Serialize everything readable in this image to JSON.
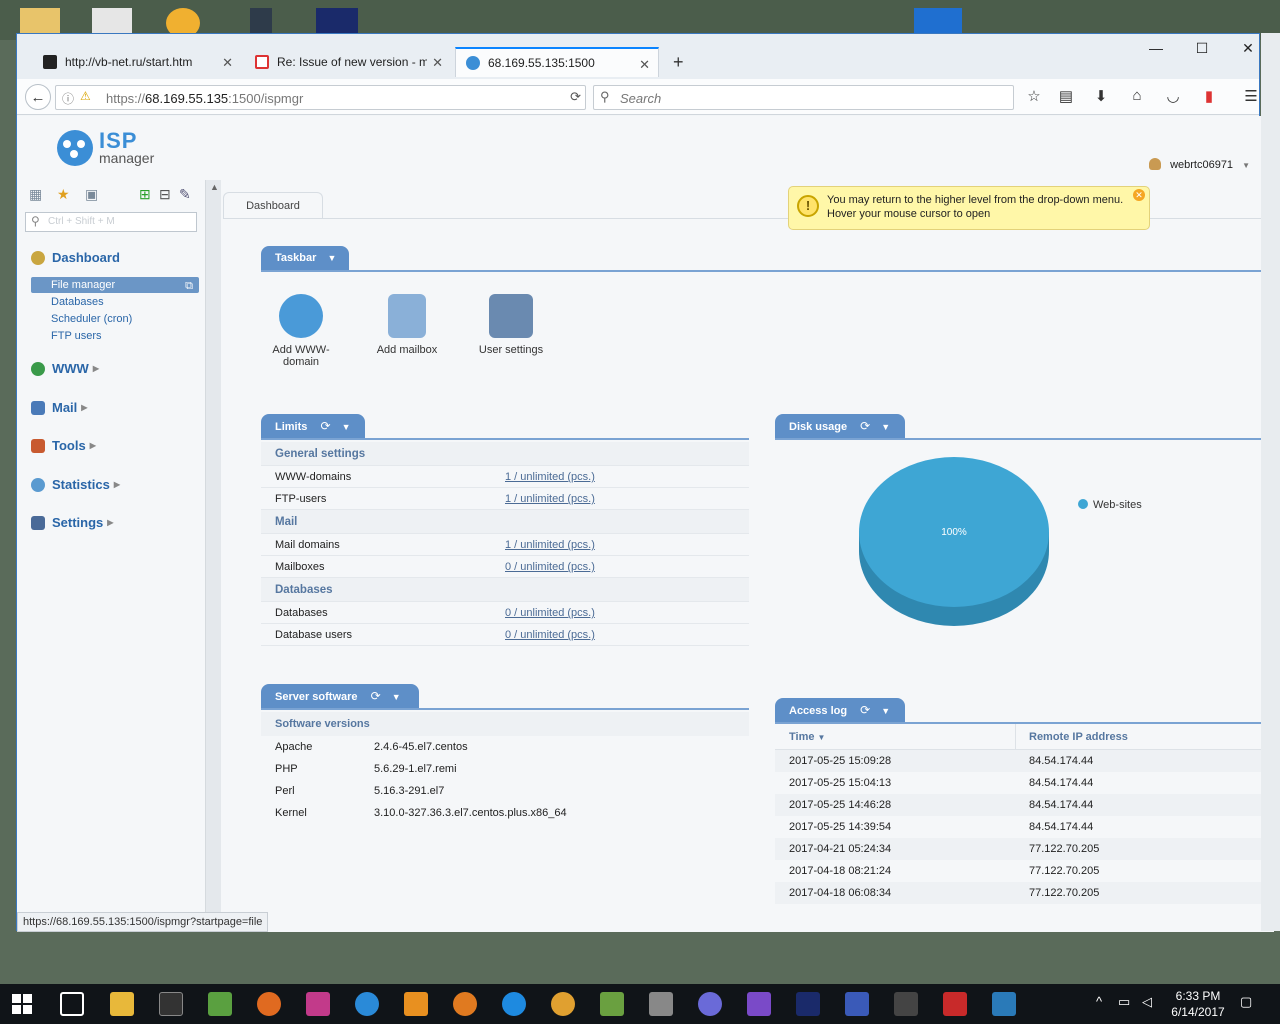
{
  "browser": {
    "tabs": [
      {
        "label": "http://vb-net.ru/start.htm",
        "icon": "vbnet-favicon-icon",
        "active": false
      },
      {
        "label": "Re: Issue of new version - m",
        "icon": "gmail-icon",
        "active": false
      },
      {
        "label": "68.169.55.135:1500",
        "icon": "isp-favicon-icon",
        "active": true
      }
    ],
    "url_prefix": "https://",
    "url_host": "68.169.55.135",
    "url_rest": ":1500/ispmgr",
    "search_placeholder": "Search",
    "status_url": "https://68.169.55.135:1500/ispmgr?startpage=file"
  },
  "app": {
    "logo_line1": "ISP",
    "logo_line2": "manager",
    "user": "webrtc06971",
    "tooltip_line1": "You may return to the higher level from the drop-down menu.",
    "tooltip_line2": "Hover your mouse cursor to open",
    "tab_label": "Dashboard",
    "search_placeholder": "Ctrl + Shift + M"
  },
  "sidebar": {
    "dashboard": "Dashboard",
    "items": [
      "File manager",
      "Databases",
      "Scheduler (cron)",
      "FTP users"
    ],
    "sections": [
      {
        "label": "WWW",
        "icon": "globe-icon"
      },
      {
        "label": "Mail",
        "icon": "mail-icon"
      },
      {
        "label": "Tools",
        "icon": "tools-icon"
      },
      {
        "label": "Statistics",
        "icon": "statistics-icon"
      },
      {
        "label": "Settings",
        "icon": "settings-icon"
      }
    ]
  },
  "taskbar_panel": {
    "title": "Taskbar",
    "items": [
      {
        "label": "Add WWW-domain",
        "icon": "globe-icon"
      },
      {
        "label": "Add mailbox",
        "icon": "mailbox-icon"
      },
      {
        "label": "User settings",
        "icon": "user-settings-icon"
      }
    ]
  },
  "limits": {
    "title": "Limits",
    "groups": [
      {
        "name": "General settings",
        "rows": [
          {
            "label": "WWW-domains",
            "value": "1 / unlimited (pcs.)"
          },
          {
            "label": "FTP-users",
            "value": "1 / unlimited (pcs.)"
          }
        ]
      },
      {
        "name": "Mail",
        "rows": [
          {
            "label": "Mail domains",
            "value": "1 / unlimited (pcs.)"
          },
          {
            "label": "Mailboxes",
            "value": "0 / unlimited (pcs.)"
          }
        ]
      },
      {
        "name": "Databases",
        "rows": [
          {
            "label": "Databases",
            "value": "0 / unlimited (pcs.)"
          },
          {
            "label": "Database users",
            "value": "0 / unlimited (pcs.)"
          }
        ]
      }
    ]
  },
  "disk_usage": {
    "title": "Disk usage",
    "slice_label": "100%",
    "legend": "Web-sites",
    "color": "#3ea6d4"
  },
  "server_software": {
    "title": "Server software",
    "group": "Software versions",
    "rows": [
      {
        "name": "Apache",
        "version": "2.4.6-45.el7.centos"
      },
      {
        "name": "PHP",
        "version": "5.6.29-1.el7.remi"
      },
      {
        "name": "Perl",
        "version": "5.16.3-291.el7"
      },
      {
        "name": "Kernel",
        "version": "3.10.0-327.36.3.el7.centos.plus.x86_64"
      }
    ]
  },
  "access_log": {
    "title": "Access log",
    "col_time": "Time",
    "col_ip": "Remote IP address",
    "rows": [
      {
        "time": "2017-05-25 15:09:28",
        "ip": "84.54.174.44"
      },
      {
        "time": "2017-05-25 15:04:13",
        "ip": "84.54.174.44"
      },
      {
        "time": "2017-05-25 14:46:28",
        "ip": "84.54.174.44"
      },
      {
        "time": "2017-05-25 14:39:54",
        "ip": "84.54.174.44"
      },
      {
        "time": "2017-04-21 05:24:34",
        "ip": "77.122.70.205"
      },
      {
        "time": "2017-04-18 08:21:24",
        "ip": "77.122.70.205"
      },
      {
        "time": "2017-04-18 06:08:34",
        "ip": "77.122.70.205"
      }
    ]
  },
  "system": {
    "time": "6:33 PM",
    "date": "6/14/2017"
  },
  "colors": {
    "accent": "#5e8fc8",
    "link": "#2a66a8"
  }
}
